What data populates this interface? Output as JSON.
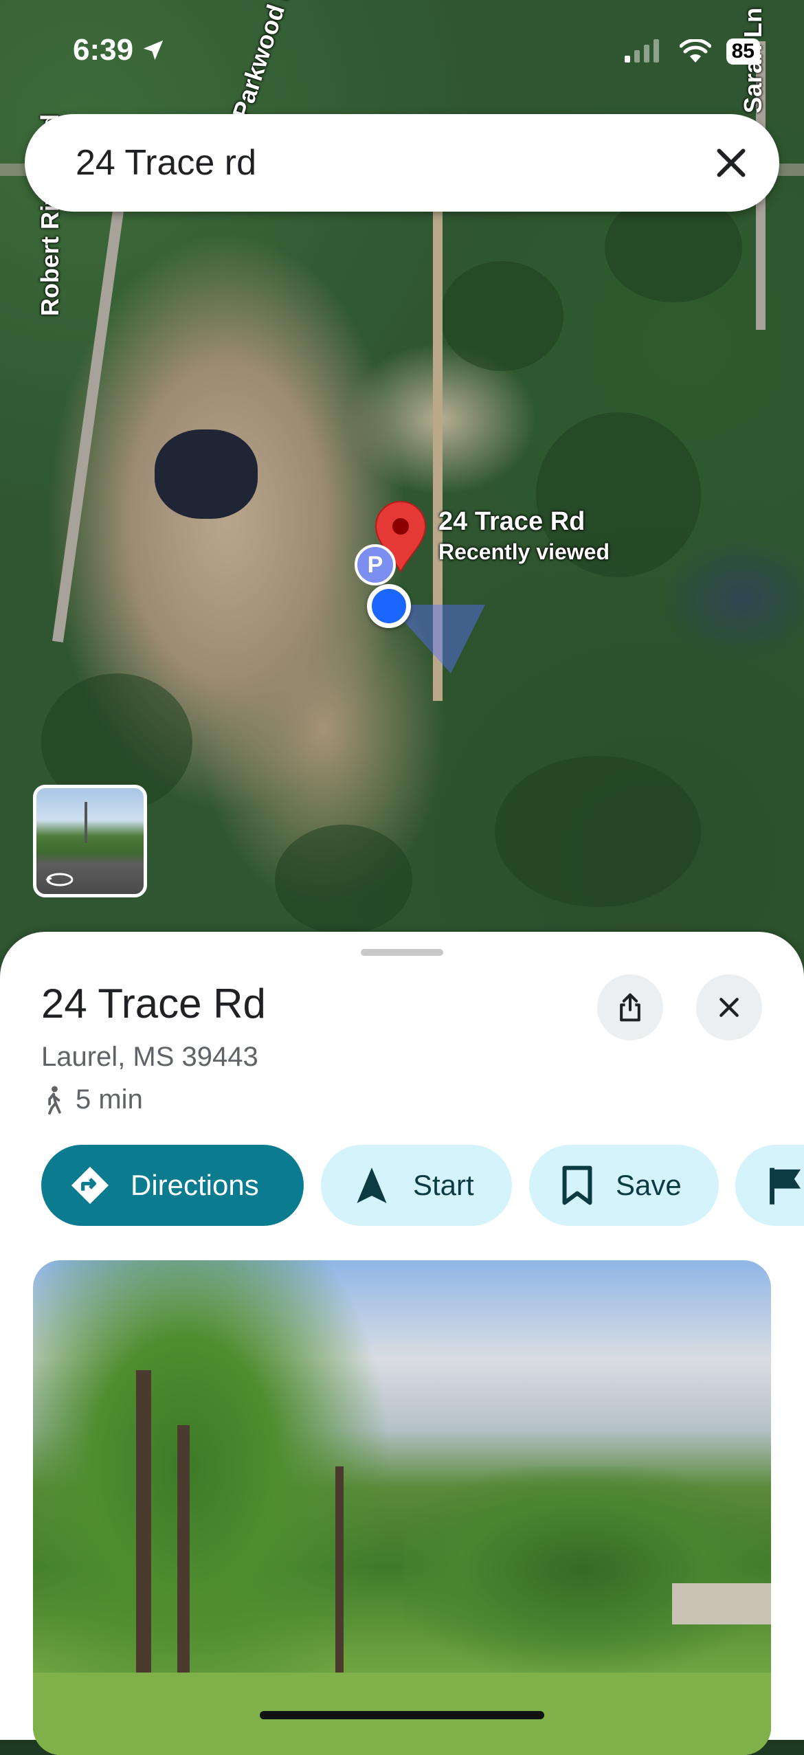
{
  "status_bar": {
    "time": "6:39",
    "battery": "85"
  },
  "search": {
    "query": "24 Trace rd"
  },
  "map": {
    "road_labels": [
      "Robert Rivers Rd",
      "Parkwood Dr",
      "Sarah Ln"
    ],
    "pin": {
      "title": "24 Trace Rd",
      "subtitle": "Recently viewed"
    },
    "parking_label": "P"
  },
  "place": {
    "title": "24 Trace Rd",
    "address": "Laurel, MS 39443",
    "walk_time": "5 min"
  },
  "actions": {
    "directions": "Directions",
    "start": "Start",
    "save": "Save"
  },
  "colors": {
    "accent": "#0b7b8f",
    "chip_bg": "#d5f3fb",
    "pin": "#e53935",
    "location": "#1a66ff"
  }
}
